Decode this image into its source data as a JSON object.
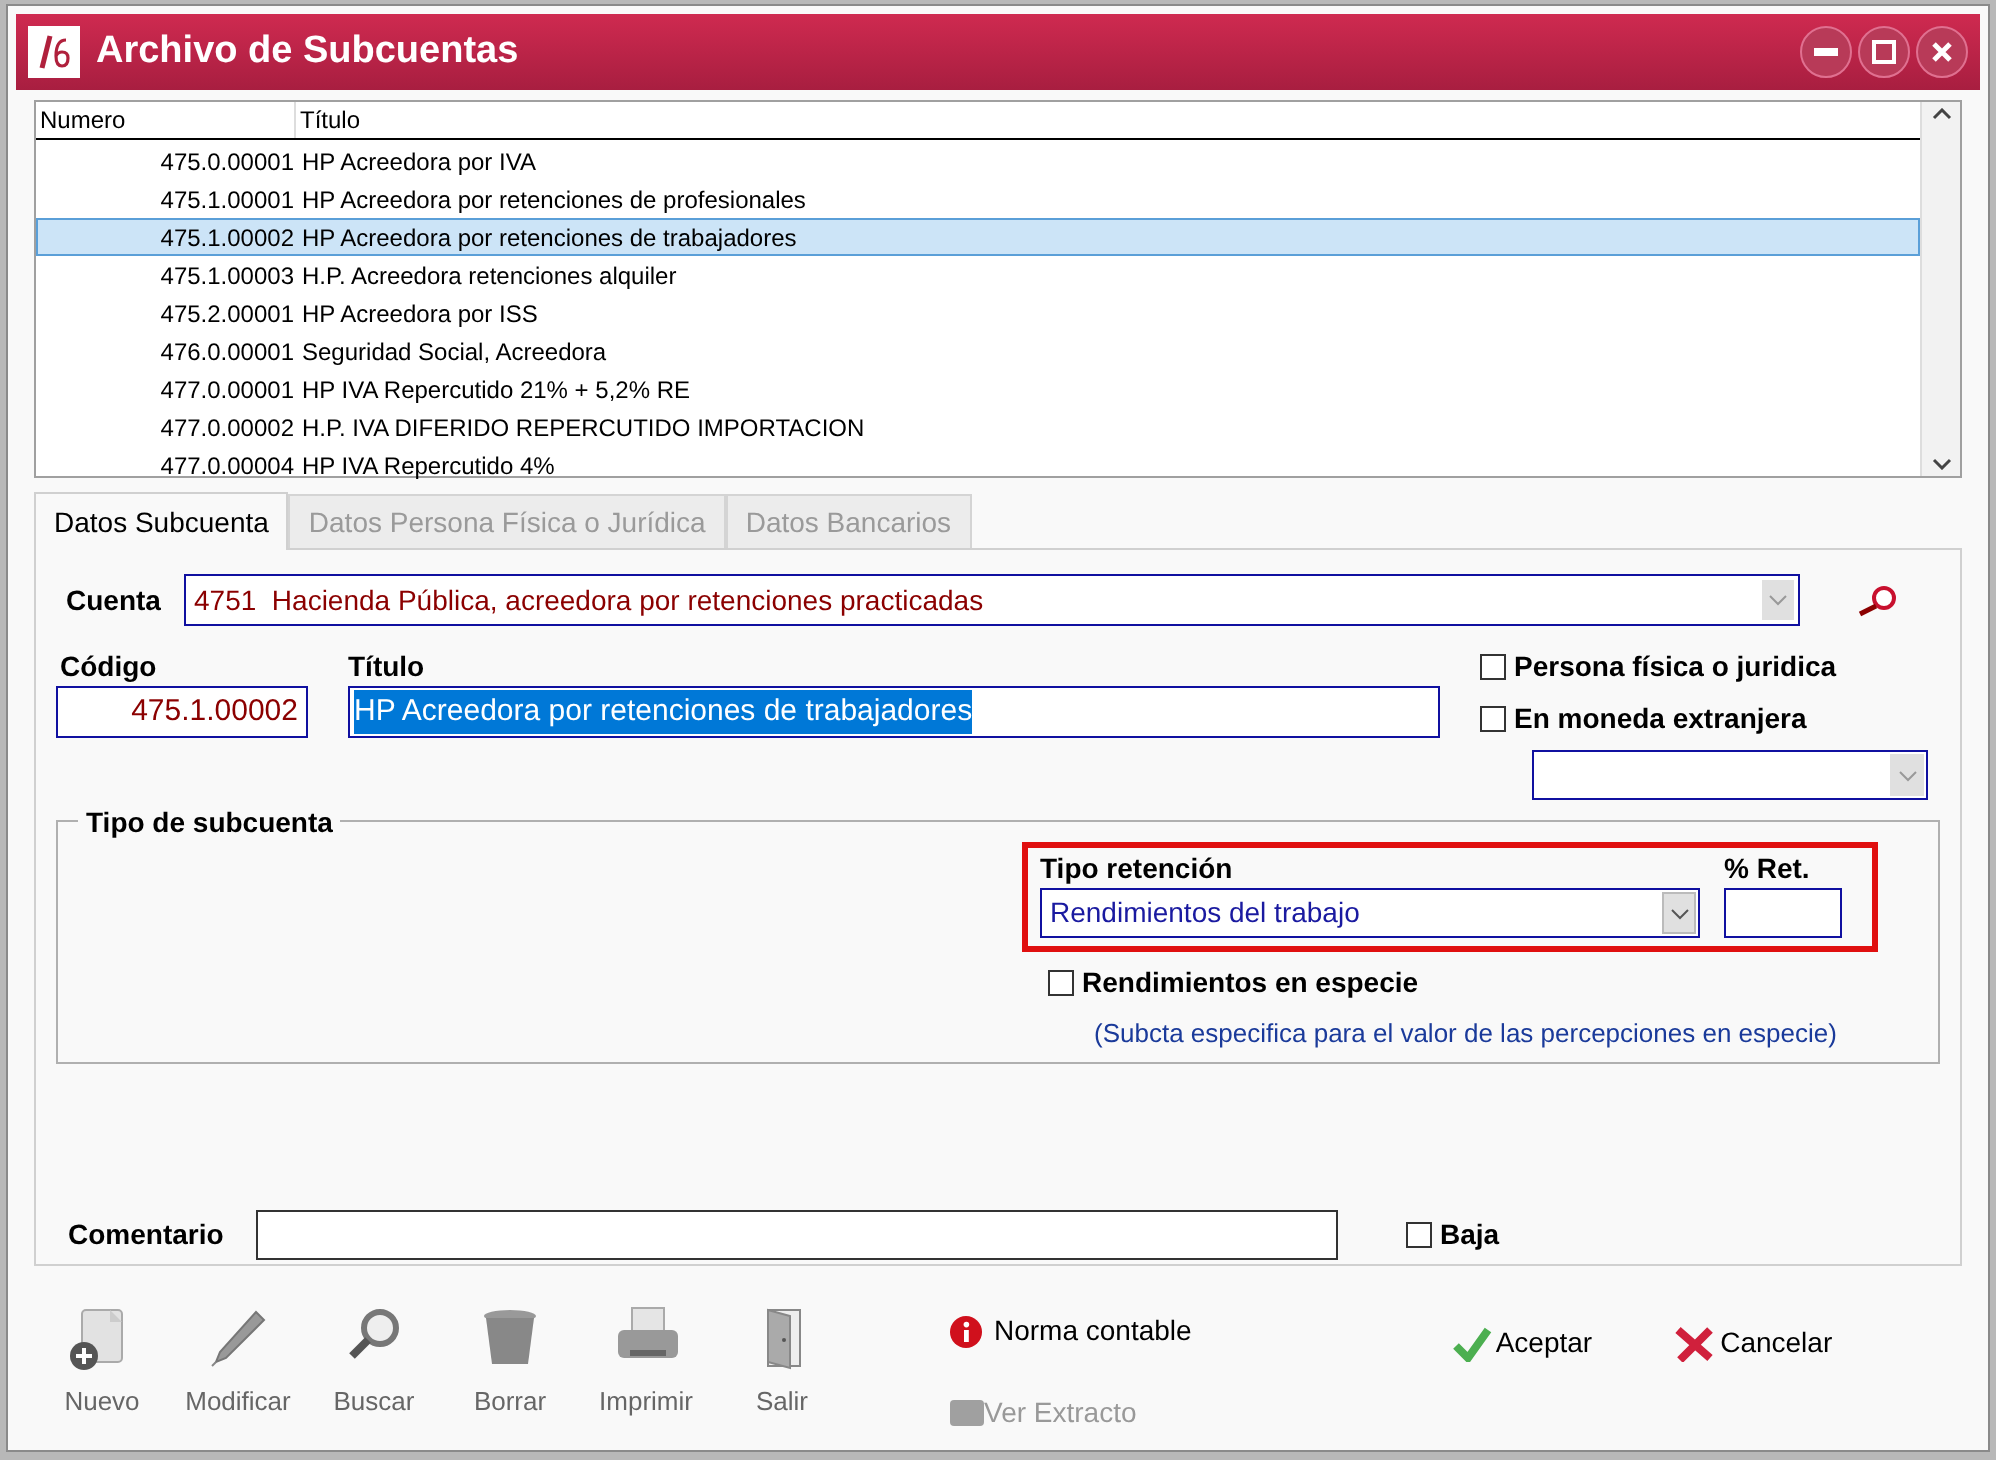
{
  "window": {
    "title": "Archivo de Subcuentas"
  },
  "list": {
    "columns": [
      "Numero",
      "Título"
    ],
    "rows": [
      {
        "numero": "475.0.00001",
        "titulo": "HP Acreedora por IVA",
        "selected": false
      },
      {
        "numero": "475.1.00001",
        "titulo": "HP Acreedora por retenciones de profesionales",
        "selected": false
      },
      {
        "numero": "475.1.00002",
        "titulo": "HP Acreedora por retenciones de trabajadores",
        "selected": true
      },
      {
        "numero": "475.1.00003",
        "titulo": "H.P. Acreedora retenciones alquiler",
        "selected": false
      },
      {
        "numero": "475.2.00001",
        "titulo": "HP Acreedora por ISS",
        "selected": false
      },
      {
        "numero": "476.0.00001",
        "titulo": "Seguridad Social, Acreedora",
        "selected": false
      },
      {
        "numero": "477.0.00001",
        "titulo": "HP IVA Repercutido 21% + 5,2% RE",
        "selected": false
      },
      {
        "numero": "477.0.00002",
        "titulo": "H.P. IVA DIFERIDO REPERCUTIDO IMPORTACION",
        "selected": false
      },
      {
        "numero": "477.0.00004",
        "titulo": "HP IVA Repercutido 4%",
        "selected": false
      }
    ]
  },
  "tabs": [
    {
      "label": "Datos Subcuenta",
      "selected": true
    },
    {
      "label": "Datos Persona Física o Jurídica",
      "selected": false
    },
    {
      "label": "Datos Bancarios",
      "selected": false
    }
  ],
  "form": {
    "cuenta": {
      "label": "Cuenta",
      "value": "4751  Hacienda Pública, acreedora por retenciones practicadas"
    },
    "codigo": {
      "label": "Código",
      "value": "475.1.00002"
    },
    "titulo": {
      "label": "Título",
      "value": "HP Acreedora por retenciones de trabajadores",
      "text_selected": true
    },
    "persona_fisica": {
      "label": "Persona física o juridica",
      "checked": false
    },
    "moneda_extranjera": {
      "label": "En moneda extranjera",
      "checked": false
    },
    "tipo_subcuenta": {
      "title": "Tipo de subcuenta",
      "tipo_retencion": {
        "label": "Tipo retención",
        "value": "Rendimientos del trabajo"
      },
      "ret": {
        "label": "% Ret."
      },
      "especie": {
        "label": "Rendimientos en especie",
        "checked": false
      },
      "note": "(Subcta especifica para el valor de las percepciones en especie)"
    },
    "comentario": {
      "label": "Comentario"
    },
    "baja": {
      "label": "Baja",
      "checked": false
    }
  },
  "toolbar": [
    {
      "label": "Nuevo",
      "kind": "new"
    },
    {
      "label": "Modificar",
      "kind": "edit"
    },
    {
      "label": "Buscar",
      "kind": "search"
    },
    {
      "label": "Borrar",
      "kind": "delete"
    },
    {
      "label": "Imprimir",
      "kind": "print"
    },
    {
      "label": "Salir",
      "kind": "exit"
    }
  ],
  "norma": {
    "label": "Norma contable"
  },
  "extracto": {
    "label": "Ver Extracto",
    "disabled": true
  },
  "aceptar": {
    "label": "Aceptar"
  },
  "cancelar": {
    "label": "Cancelar"
  }
}
